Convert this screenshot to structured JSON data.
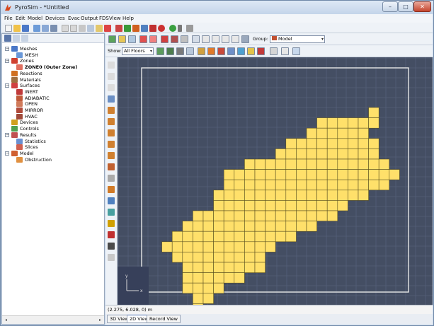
{
  "window": {
    "title": "PyroSim - *Untitled",
    "controls": {
      "minimize": "–",
      "maximize": "□",
      "close": "✕"
    }
  },
  "menu": [
    "File",
    "Edit",
    "Model",
    "Devices",
    "Evac",
    "Output",
    "FDS",
    "View",
    "Help"
  ],
  "toolbar": {
    "icons": [
      "new-icon",
      "open-icon",
      "save-icon",
      "separator",
      "undo-icon",
      "redo-icon",
      "cut-icon",
      "copy-icon",
      "paste-icon",
      "delete-icon",
      "obstruction-icon",
      "hole-icon",
      "vent-icon",
      "wall-icon",
      "slab-icon",
      "run-fds-icon",
      "dropdown-icon"
    ]
  },
  "tree": {
    "items": [
      {
        "label": "Meshes",
        "icon": "mesh-group-icon",
        "expand": "−",
        "level": 0
      },
      {
        "label": "MESH",
        "icon": "mesh-icon",
        "level": 1
      },
      {
        "label": "Zones",
        "icon": "zones-icon",
        "expand": "−",
        "level": 0
      },
      {
        "label": "ZONE0 (Outer Zone)",
        "icon": "zone-icon",
        "level": 1,
        "bold": true
      },
      {
        "label": "Reactions",
        "icon": "reactions-icon",
        "level": 0
      },
      {
        "label": "Materials",
        "icon": "materials-icon",
        "level": 0
      },
      {
        "label": "Surfaces",
        "icon": "surfaces-icon",
        "expand": "−",
        "level": 0
      },
      {
        "label": "INERT",
        "icon": "surface-inert-icon",
        "level": 1
      },
      {
        "label": "ADIABATIC",
        "icon": "surface-adiabatic-icon",
        "level": 1
      },
      {
        "label": "OPEN",
        "icon": "surface-open-icon",
        "level": 1
      },
      {
        "label": "MIRROR",
        "icon": "surface-mirror-icon",
        "level": 1
      },
      {
        "label": "HVAC",
        "icon": "surface-hvac-icon",
        "level": 1
      },
      {
        "label": "Devices",
        "icon": "devices-icon",
        "level": 0
      },
      {
        "label": "Controls",
        "icon": "controls-icon",
        "level": 0
      },
      {
        "label": "Results",
        "icon": "results-icon",
        "expand": "−",
        "level": 0
      },
      {
        "label": "Statistics",
        "icon": "statistics-icon",
        "level": 1
      },
      {
        "label": "Slices",
        "icon": "slices-icon",
        "level": 1
      },
      {
        "label": "Model",
        "icon": "model-icon",
        "expand": "−",
        "level": 0
      },
      {
        "label": "Obstruction",
        "icon": "obstruction-icon",
        "level": 1
      }
    ]
  },
  "view_toolbar": {
    "group_label": "Group:",
    "group_value": "Model",
    "show_label": "Show:",
    "show_value": "All Floors"
  },
  "viewport": {
    "background": "#444e63",
    "grid_color": "#5b6680",
    "cell_color": "#ffe06a",
    "cell_border": "#5a5020",
    "boundary_color": "#e8e8e8",
    "axes": {
      "y_label": "y",
      "x_label": "x"
    }
  },
  "status": {
    "coordinates": "(2.275, 6.028, 0) m"
  },
  "tabs": [
    "3D View",
    "2D View",
    "Record View"
  ],
  "active_tab": "2D View"
}
